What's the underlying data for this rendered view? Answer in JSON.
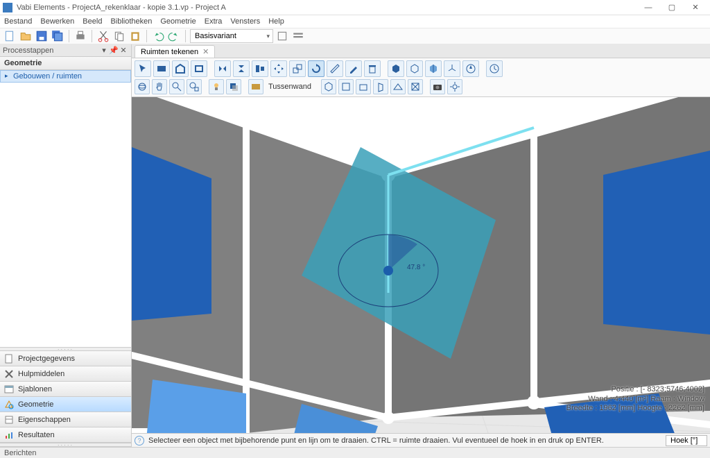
{
  "titlebar": {
    "title": "Vabi Elements - ProjectA_rekenklaar - kopie 3.1.vp - Project A"
  },
  "menu": {
    "items": [
      "Bestand",
      "Bewerken",
      "Beeld",
      "Bibliotheken",
      "Geometrie",
      "Extra",
      "Vensters",
      "Help"
    ]
  },
  "toolbar1": {
    "variant": "Basisvariant"
  },
  "left_panel": {
    "header": "Processtappen",
    "section_title": "Geometrie",
    "tree_root": "Gebouwen / ruimten",
    "nav": {
      "projectgegevens": "Projectgegevens",
      "hulpmiddelen": "Hulpmiddelen",
      "sjablonen": "Sjablonen",
      "geometrie": "Geometrie",
      "eigenschappen": "Eigenschappen",
      "resultaten": "Resultaten"
    }
  },
  "tab": {
    "label": "Ruimten tekenen"
  },
  "row2": {
    "wall_label": "Tussenwand"
  },
  "viewport": {
    "angle_label": "47.8 °",
    "info": {
      "pos_label": "Positie :",
      "pos_value": "[- 8323;5746;4002]",
      "wand_label": "Wand :",
      "wand_value": "4.440 [m²] Raam : Window",
      "breedte_label": "Breedte :",
      "breedte_value": "1962 [mm] Hoogte : 2262 [mm]"
    }
  },
  "status": {
    "msg": "Selecteer een object met bijbehorende punt en lijn om te draaien. CTRL = ruimte draaien. Vul eventueel de hoek in en druk op ENTER.",
    "hoek_label": "Hoek [°]"
  },
  "bottom": {
    "label": "Berichten"
  }
}
